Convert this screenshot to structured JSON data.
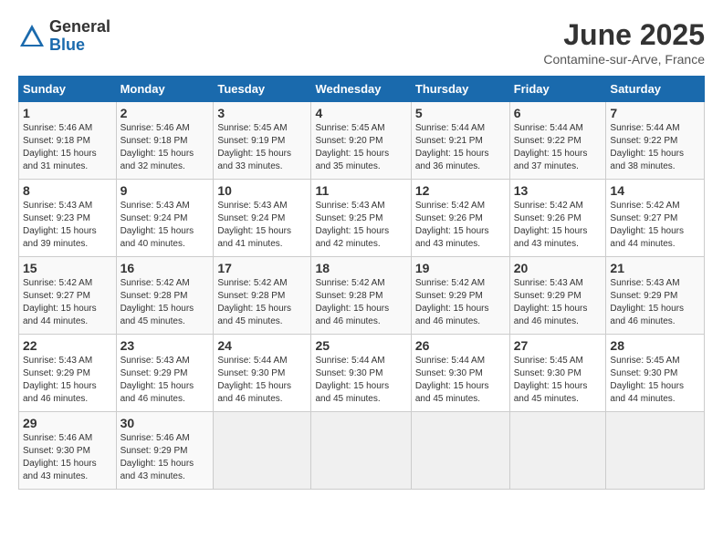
{
  "header": {
    "logo_general": "General",
    "logo_blue": "Blue",
    "month_title": "June 2025",
    "location": "Contamine-sur-Arve, France"
  },
  "calendar": {
    "columns": [
      "Sunday",
      "Monday",
      "Tuesday",
      "Wednesday",
      "Thursday",
      "Friday",
      "Saturday"
    ],
    "weeks": [
      [
        null,
        {
          "day": "2",
          "info": "Sunrise: 5:46 AM\nSunset: 9:18 PM\nDaylight: 15 hours\nand 32 minutes."
        },
        {
          "day": "3",
          "info": "Sunrise: 5:45 AM\nSunset: 9:19 PM\nDaylight: 15 hours\nand 33 minutes."
        },
        {
          "day": "4",
          "info": "Sunrise: 5:45 AM\nSunset: 9:20 PM\nDaylight: 15 hours\nand 35 minutes."
        },
        {
          "day": "5",
          "info": "Sunrise: 5:44 AM\nSunset: 9:21 PM\nDaylight: 15 hours\nand 36 minutes."
        },
        {
          "day": "6",
          "info": "Sunrise: 5:44 AM\nSunset: 9:22 PM\nDaylight: 15 hours\nand 37 minutes."
        },
        {
          "day": "7",
          "info": "Sunrise: 5:44 AM\nSunset: 9:22 PM\nDaylight: 15 hours\nand 38 minutes."
        }
      ],
      [
        {
          "day": "1",
          "info": "Sunrise: 5:46 AM\nSunset: 9:18 PM\nDaylight: 15 hours\nand 31 minutes."
        },
        null,
        null,
        null,
        null,
        null,
        null
      ],
      [
        {
          "day": "8",
          "info": "Sunrise: 5:43 AM\nSunset: 9:23 PM\nDaylight: 15 hours\nand 39 minutes."
        },
        {
          "day": "9",
          "info": "Sunrise: 5:43 AM\nSunset: 9:24 PM\nDaylight: 15 hours\nand 40 minutes."
        },
        {
          "day": "10",
          "info": "Sunrise: 5:43 AM\nSunset: 9:24 PM\nDaylight: 15 hours\nand 41 minutes."
        },
        {
          "day": "11",
          "info": "Sunrise: 5:43 AM\nSunset: 9:25 PM\nDaylight: 15 hours\nand 42 minutes."
        },
        {
          "day": "12",
          "info": "Sunrise: 5:42 AM\nSunset: 9:26 PM\nDaylight: 15 hours\nand 43 minutes."
        },
        {
          "day": "13",
          "info": "Sunrise: 5:42 AM\nSunset: 9:26 PM\nDaylight: 15 hours\nand 43 minutes."
        },
        {
          "day": "14",
          "info": "Sunrise: 5:42 AM\nSunset: 9:27 PM\nDaylight: 15 hours\nand 44 minutes."
        }
      ],
      [
        {
          "day": "15",
          "info": "Sunrise: 5:42 AM\nSunset: 9:27 PM\nDaylight: 15 hours\nand 44 minutes."
        },
        {
          "day": "16",
          "info": "Sunrise: 5:42 AM\nSunset: 9:28 PM\nDaylight: 15 hours\nand 45 minutes."
        },
        {
          "day": "17",
          "info": "Sunrise: 5:42 AM\nSunset: 9:28 PM\nDaylight: 15 hours\nand 45 minutes."
        },
        {
          "day": "18",
          "info": "Sunrise: 5:42 AM\nSunset: 9:28 PM\nDaylight: 15 hours\nand 46 minutes."
        },
        {
          "day": "19",
          "info": "Sunrise: 5:42 AM\nSunset: 9:29 PM\nDaylight: 15 hours\nand 46 minutes."
        },
        {
          "day": "20",
          "info": "Sunrise: 5:43 AM\nSunset: 9:29 PM\nDaylight: 15 hours\nand 46 minutes."
        },
        {
          "day": "21",
          "info": "Sunrise: 5:43 AM\nSunset: 9:29 PM\nDaylight: 15 hours\nand 46 minutes."
        }
      ],
      [
        {
          "day": "22",
          "info": "Sunrise: 5:43 AM\nSunset: 9:29 PM\nDaylight: 15 hours\nand 46 minutes."
        },
        {
          "day": "23",
          "info": "Sunrise: 5:43 AM\nSunset: 9:29 PM\nDaylight: 15 hours\nand 46 minutes."
        },
        {
          "day": "24",
          "info": "Sunrise: 5:44 AM\nSunset: 9:30 PM\nDaylight: 15 hours\nand 46 minutes."
        },
        {
          "day": "25",
          "info": "Sunrise: 5:44 AM\nSunset: 9:30 PM\nDaylight: 15 hours\nand 45 minutes."
        },
        {
          "day": "26",
          "info": "Sunrise: 5:44 AM\nSunset: 9:30 PM\nDaylight: 15 hours\nand 45 minutes."
        },
        {
          "day": "27",
          "info": "Sunrise: 5:45 AM\nSunset: 9:30 PM\nDaylight: 15 hours\nand 45 minutes."
        },
        {
          "day": "28",
          "info": "Sunrise: 5:45 AM\nSunset: 9:30 PM\nDaylight: 15 hours\nand 44 minutes."
        }
      ],
      [
        {
          "day": "29",
          "info": "Sunrise: 5:46 AM\nSunset: 9:30 PM\nDaylight: 15 hours\nand 43 minutes."
        },
        {
          "day": "30",
          "info": "Sunrise: 5:46 AM\nSunset: 9:29 PM\nDaylight: 15 hours\nand 43 minutes."
        },
        null,
        null,
        null,
        null,
        null
      ]
    ]
  }
}
